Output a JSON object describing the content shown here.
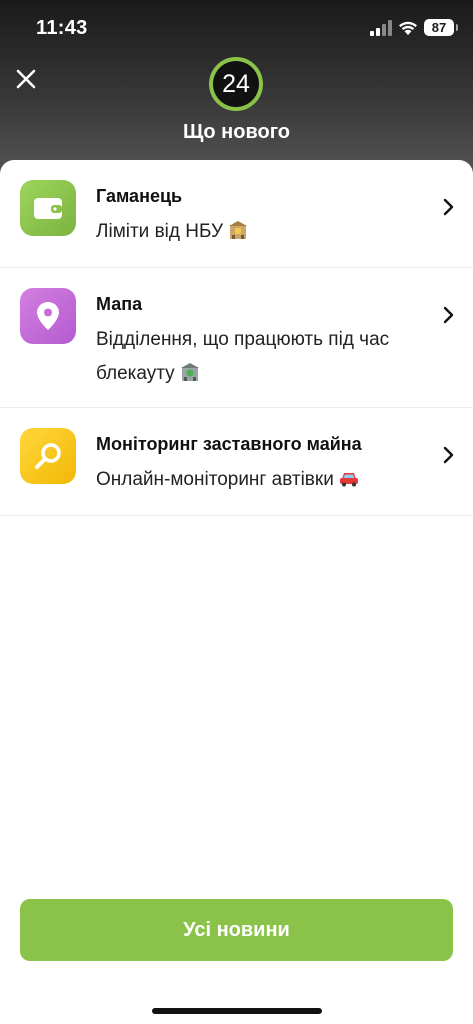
{
  "status_bar": {
    "time": "11:43",
    "battery": "87"
  },
  "header": {
    "logo_text": "24",
    "title": "Що нового",
    "close_icon": "close-icon"
  },
  "items": [
    {
      "title": "Гаманець",
      "subtitle": "Ліміти від НБУ",
      "icon": "wallet-icon",
      "color": "#8bc34a",
      "emoji": "bank-emoji"
    },
    {
      "title": "Мапа",
      "subtitle_line1": "Відділення, що працюють під час",
      "subtitle_line2": "блекауту",
      "icon": "map-pin-icon",
      "color": "#c86dd7",
      "emoji": "bank-emoji"
    },
    {
      "title": "Моніторинг заставного майна",
      "subtitle": "Онлайн-моніторинг автівки",
      "icon": "search-icon",
      "color": "#f7c51e",
      "emoji": "car-emoji"
    }
  ],
  "footer": {
    "button_label": "Усі новини",
    "accent": "#8bc34a"
  }
}
